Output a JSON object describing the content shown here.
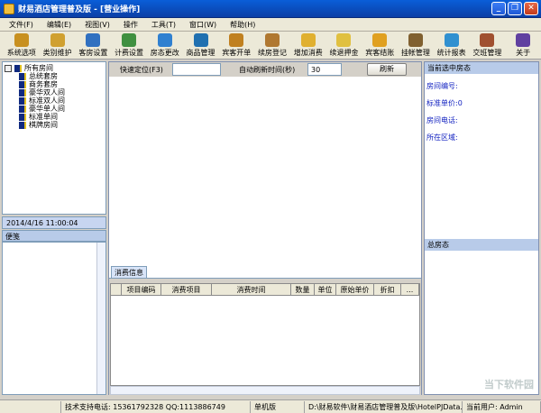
{
  "window": {
    "title": "财易酒店管理普及版 - [营业操作]",
    "controls": [
      "_",
      "❐",
      "✕"
    ]
  },
  "menu": [
    "文件(F)",
    "编辑(E)",
    "视图(V)",
    "操作",
    "工具(T)",
    "窗口(W)",
    "帮助(H)"
  ],
  "toolbar": [
    {
      "label": "系统选项",
      "color": "#c89020"
    },
    {
      "label": "类别维护",
      "color": "#d0a030"
    },
    {
      "label": "客房设置",
      "color": "#3070c0"
    },
    {
      "label": "计费设置",
      "color": "#409040"
    },
    {
      "label": "房态更改",
      "color": "#3080d0"
    },
    {
      "label": "商品管理",
      "color": "#2070b0"
    },
    {
      "label": "宾客开单",
      "color": "#c08020"
    },
    {
      "label": "续房登记",
      "color": "#b07830"
    },
    {
      "label": "增加消费",
      "color": "#e0b030"
    },
    {
      "label": "续退押金",
      "color": "#e0c040"
    },
    {
      "label": "宾客结账",
      "color": "#e0a020"
    },
    {
      "label": "挂帐管理",
      "color": "#806030"
    },
    {
      "label": "统计报表",
      "color": "#3090d0"
    },
    {
      "label": "交班管理",
      "color": "#a05030"
    },
    {
      "label": "关于",
      "color": "#6040a0"
    }
  ],
  "tree": {
    "root": "所有房间",
    "items": [
      "总统套房",
      "商务套房",
      "豪华双人间",
      "标准双人间",
      "豪华单人间",
      "标准单间",
      "棋牌房间"
    ]
  },
  "datetime": "2014/4/16 11:00:04",
  "memo": {
    "label": "便笺"
  },
  "quick": {
    "locate_label": "快速定位(F3)",
    "locate_value": "",
    "refresh_label": "自动刷新时间(秒)",
    "refresh_value": "30",
    "refresh_button": "刷新"
  },
  "detail": {
    "tab": "消费信息",
    "columns": [
      "项目编码",
      "消费项目",
      "消费时间",
      "数量",
      "单位",
      "原始单价",
      "折扣",
      "..."
    ]
  },
  "right": {
    "header": "当前选中房态",
    "fields": [
      "房间编号:",
      "标准单价:0",
      "房间电话:",
      "所在区域:"
    ],
    "header2": "总房态"
  },
  "status": {
    "support": "技术支持电话: 15361792328 QQ:1113886749",
    "edition": "单机版",
    "path": "D:\\财易软件\\财易酒店管理普及版\\HotelPJData.sys",
    "user": "当前用户: Admin"
  },
  "watermark": "当下软件园"
}
